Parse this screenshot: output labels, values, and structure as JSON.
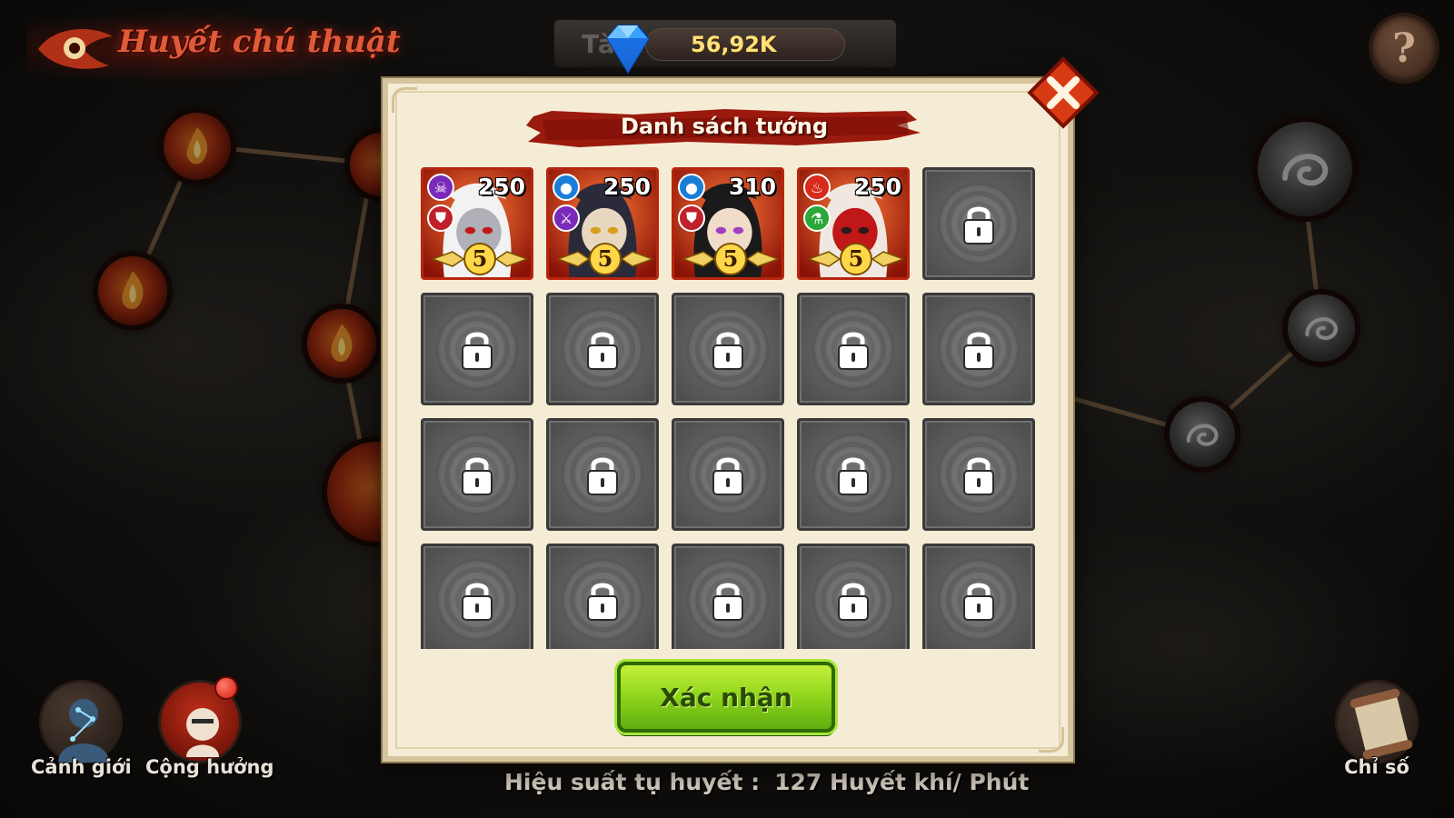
{
  "header": {
    "title": "Huyết chú thuật",
    "currency_bg_text": "Tài Nguyên",
    "currency_value": "56,92K",
    "help_label": "?"
  },
  "modal": {
    "title": "Danh sách tướng",
    "confirm_label": "Xác nhận",
    "heroes": [
      {
        "power": "250",
        "stars": "5",
        "badge1": "demon-icon",
        "badge2": "armor-icon",
        "badge1_color": "#7a2ab8",
        "badge2_color": "#c0202a"
      },
      {
        "power": "250",
        "stars": "5",
        "badge1": "water-icon",
        "badge2": "sword-icon",
        "badge1_color": "#1a7ed8",
        "badge2_color": "#7a2ab8"
      },
      {
        "power": "310",
        "stars": "5",
        "badge1": "water-icon",
        "badge2": "armor-icon",
        "badge1_color": "#1a7ed8",
        "badge2_color": "#c0202a"
      },
      {
        "power": "250",
        "stars": "5",
        "badge1": "fire-icon",
        "badge2": "potion-icon",
        "badge1_color": "#d82a1a",
        "badge2_color": "#2aa83a"
      }
    ],
    "locked_slot_count": 16
  },
  "bottom": {
    "realm_label": "Cảnh giới",
    "resonance_label": "Cộng hưởng",
    "stats_label": "Chỉ số",
    "efficiency_label": "Hiệu suất tụ huyết :",
    "efficiency_value": "127 Huyết khí/ Phút"
  }
}
